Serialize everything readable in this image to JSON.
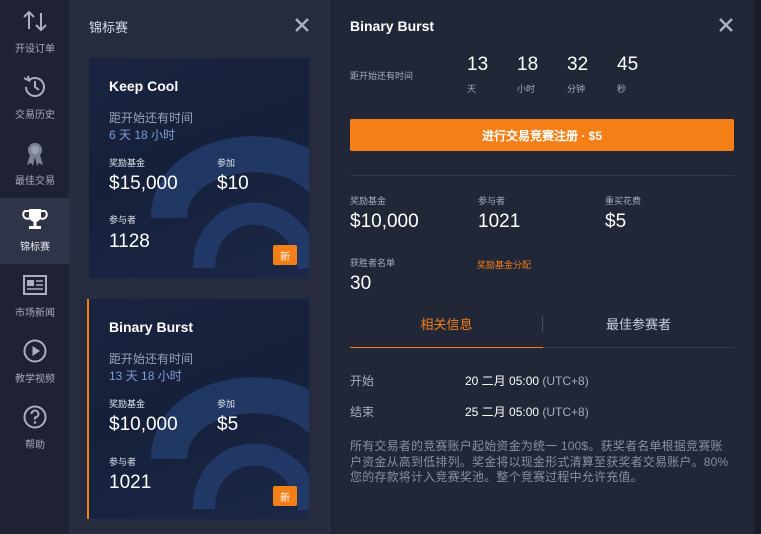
{
  "sidebar": {
    "items": [
      {
        "label": "开设订单",
        "icon": "sort-arrows-icon"
      },
      {
        "label": "交易历史",
        "icon": "history-clock-icon"
      },
      {
        "label": "最佳交易",
        "icon": "award-ribbon-icon"
      },
      {
        "label": "锦标赛",
        "icon": "trophy-icon",
        "active": true
      },
      {
        "label": "市场新闻",
        "icon": "newspaper-icon"
      },
      {
        "label": "教学视频",
        "icon": "play-circle-icon"
      },
      {
        "label": "帮助",
        "icon": "question-circle-icon"
      }
    ]
  },
  "list_panel": {
    "title": "锦标赛",
    "cards": [
      {
        "name": "Keep Cool",
        "until_label": "距开始还有时间",
        "time": "6 天 18 小时",
        "prize_label": "奖励基金",
        "prize": "$15,000",
        "fee_label": "参加",
        "fee": "$10",
        "participants_label": "参与者",
        "participants": "1128",
        "badge": "新"
      },
      {
        "name": "Binary Burst",
        "until_label": "距开始还有时间",
        "time": "13 天 18 小时",
        "prize_label": "奖励基金",
        "prize": "$10,000",
        "fee_label": "参加",
        "fee": "$5",
        "participants_label": "参与者",
        "participants": "1021",
        "badge": "新",
        "selected": true
      }
    ]
  },
  "detail": {
    "title": "Binary Burst",
    "until_label": "距开始还有时间",
    "countdown": [
      {
        "value": "13",
        "unit": "天"
      },
      {
        "value": "18",
        "unit": "小时"
      },
      {
        "value": "32",
        "unit": "分钟"
      },
      {
        "value": "45",
        "unit": "秒"
      }
    ],
    "register_label": "进行交易竞赛注册 · $5",
    "stats": {
      "prize_label": "奖励基金",
      "prize": "$10,000",
      "participants_label": "参与者",
      "participants": "1021",
      "rebuy_label": "重买花费",
      "rebuy": "$5",
      "winners_label": "获胜者名单",
      "winners": "30",
      "distribution_link": "奖励基金分配"
    },
    "tabs": [
      {
        "label": "相关信息",
        "active": true
      },
      {
        "label": "最佳参赛者",
        "active": false
      }
    ],
    "info": {
      "start_label": "开始",
      "start_value": "20 二月 05:00",
      "start_tz": "(UTC+8)",
      "end_label": "结束",
      "end_value": "25 二月 05:00",
      "end_tz": "(UTC+8)"
    },
    "description": "所有交易者的竞赛账户起始资金为统一 100$。获奖者名单根据竞赛账户资金从高到低排列。奖金将以现金形式清算至获奖者交易账户。80%您的存款将计入竞赛奖池。整个竞赛过程中允许充值。"
  },
  "colors": {
    "accent": "#f57f17",
    "sidebar_bg": "#1e2232",
    "panel_bg": "#262b3d",
    "detail_bg": "#222738"
  }
}
